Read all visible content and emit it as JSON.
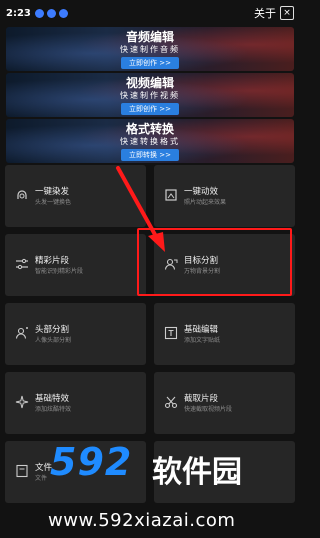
{
  "status": {
    "time": "2:23",
    "about": "关于",
    "close": "×"
  },
  "banners": [
    {
      "title": "音频编辑",
      "sub": "快速制作音频",
      "button": "立即创作 >>"
    },
    {
      "title": "视频编辑",
      "sub": "快速制作视频",
      "button": "立即创作 >>"
    },
    {
      "title": "格式转换",
      "sub": "快速转换格式",
      "button": "立即转换 >>"
    }
  ],
  "cards": [
    {
      "label": "一键染发",
      "desc": "头发一键换色",
      "icon": "hair-dye-icon"
    },
    {
      "label": "一键动效",
      "desc": "照片动起来效果",
      "icon": "motion-effect-icon"
    },
    {
      "label": "精彩片段",
      "desc": "智能识别精彩片段",
      "icon": "sliders-icon"
    },
    {
      "label": "目标分割",
      "desc": "万物背景分割",
      "icon": "person-segment-icon"
    },
    {
      "label": "头部分割",
      "desc": "人像头部分割",
      "icon": "head-segment-icon"
    },
    {
      "label": "基础编辑",
      "desc": "添加文字贴纸",
      "icon": "text-edit-icon"
    },
    {
      "label": "基础特效",
      "desc": "添加炫酷特效",
      "icon": "sparkle-icon"
    },
    {
      "label": "截取片段",
      "desc": "快速截取视频片段",
      "icon": "scissors-icon"
    },
    {
      "label": "文件",
      "desc": "文件",
      "icon": "file-icon"
    },
    {
      "label": "",
      "desc": "",
      "icon": ""
    }
  ],
  "watermark": {
    "logo": "592",
    "name": "软件园",
    "url": "www.592xiazai.com"
  },
  "colors": {
    "accent": "#2a7fe0",
    "highlight": "#ff1a1a",
    "watermark_blue": "#1f8bff"
  }
}
